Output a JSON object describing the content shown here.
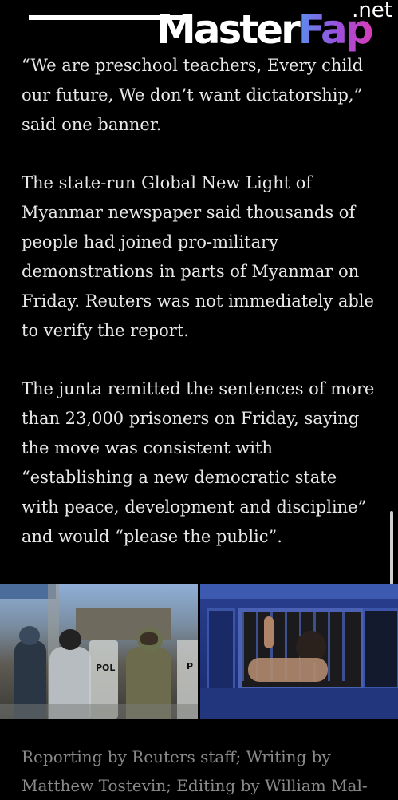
{
  "watermark": {
    "brand_main": "Master",
    "brand_accent": "Fap",
    "brand_suffix": ".net"
  },
  "article": {
    "paragraphs": [
      "“We are preschool teachers, Every child our future, We don’t want dictatorship,” said one banner.",
      "The state-run Global New Light of Myanmar newspaper said thousands of people had joined pro-military demonstrations in parts of Myanmar on Friday. Reuters was not immediately able to verify the report.",
      "The junta remitted the sentences of more than 23,000 prisoners on Friday, saying the move was consistent with “establishing a new democratic state with peace, development and discipline” and would “please the public”."
    ]
  },
  "photos": {
    "left_shield_text": "POL",
    "left_shield_text_2": "P"
  },
  "caption": {
    "text": "Reporting by Reuters staff; Writing by Matthew Tostevin; Editing by William Mal-"
  }
}
